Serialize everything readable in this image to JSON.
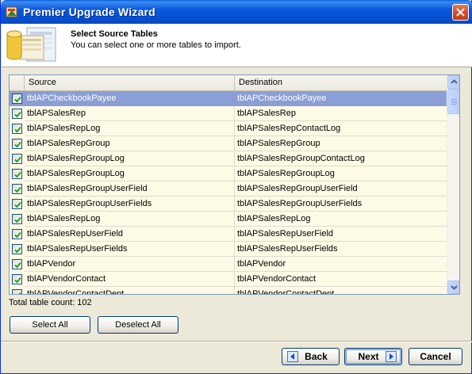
{
  "window": {
    "title": "Premier Upgrade Wizard",
    "title_icon": "wizard-icon"
  },
  "header": {
    "title": "Select Source Tables",
    "subtitle": "You can select one or more tables to import.",
    "icon": "database-tables-icon"
  },
  "table": {
    "columns": [
      "Source",
      "Destination"
    ],
    "rows": [
      {
        "checked": true,
        "source": "tblAPCheckbookPayee",
        "destination": "tblAPCheckbookPayee",
        "selected": true
      },
      {
        "checked": true,
        "source": "tblAPSalesRep",
        "destination": "tblAPSalesRep"
      },
      {
        "checked": true,
        "source": "tblAPSalesRepLog",
        "destination": "tblAPSalesRepContactLog"
      },
      {
        "checked": true,
        "source": "tblAPSalesRepGroup",
        "destination": "tblAPSalesRepGroup"
      },
      {
        "checked": true,
        "source": "tblAPSalesRepGroupLog",
        "destination": "tblAPSalesRepGroupContactLog"
      },
      {
        "checked": true,
        "source": "tblAPSalesRepGroupLog",
        "destination": "tblAPSalesRepGroupLog"
      },
      {
        "checked": true,
        "source": "tblAPSalesRepGroupUserField",
        "destination": "tblAPSalesRepGroupUserField"
      },
      {
        "checked": true,
        "source": "tblAPSalesRepGroupUserFields",
        "destination": "tblAPSalesRepGroupUserFields"
      },
      {
        "checked": true,
        "source": "tblAPSalesRepLog",
        "destination": "tblAPSalesRepLog"
      },
      {
        "checked": true,
        "source": "tblAPSalesRepUserField",
        "destination": "tblAPSalesRepUserField"
      },
      {
        "checked": true,
        "source": "tblAPSalesRepUserFields",
        "destination": "tblAPSalesRepUserFields"
      },
      {
        "checked": true,
        "source": "tblAPVendor",
        "destination": "tblAPVendor"
      },
      {
        "checked": true,
        "source": "tblAPVendorContact",
        "destination": "tblAPVendorContact"
      },
      {
        "checked": true,
        "source": "tblAPVendorContactDept",
        "destination": "tblAPVendorContactDept"
      }
    ]
  },
  "status": {
    "count_text": "Total table count: 102"
  },
  "buttons": {
    "select_all": "Select All",
    "deselect_all": "Deselect All",
    "back": "Back",
    "next": "Next",
    "cancel": "Cancel"
  },
  "colors": {
    "selected_row": "#8b9fd6",
    "row_bg": "#fdfbe5",
    "title_bar": "#0b58dc",
    "dialog_bg": "#ece9d8"
  }
}
